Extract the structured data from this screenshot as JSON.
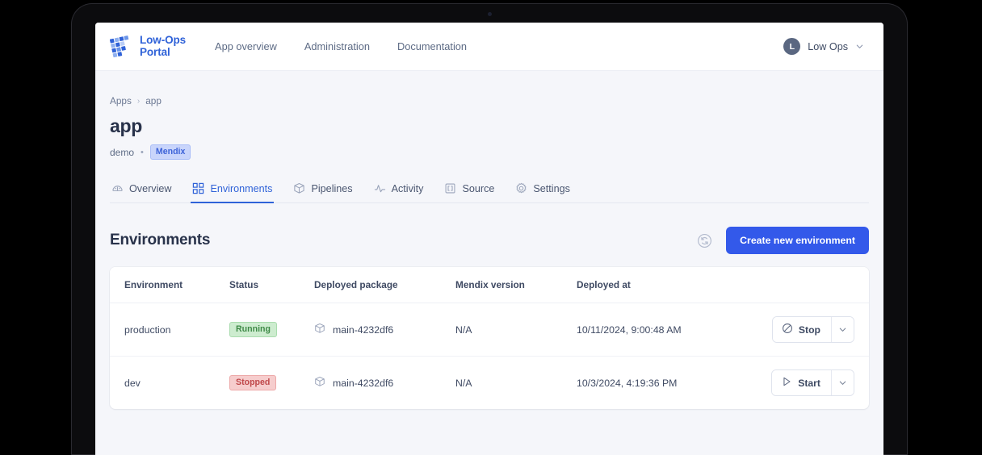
{
  "brand": {
    "name": "Low-Ops\nPortal",
    "logo_icon": "mosaic-logo-icon",
    "accent_color": "#2f62d8"
  },
  "topnav": {
    "links": [
      {
        "label": "App overview"
      },
      {
        "label": "Administration"
      },
      {
        "label": "Documentation"
      }
    ],
    "user": {
      "initial": "L",
      "name": "Low Ops",
      "caret_icon": "chevron-down-icon"
    }
  },
  "breadcrumb": {
    "items": [
      {
        "label": "Apps"
      },
      {
        "label": "app"
      }
    ],
    "separator": "›"
  },
  "page": {
    "title": "app",
    "owner": "demo",
    "separator_dot": "•",
    "tech_badge": "Mendix"
  },
  "tabs": [
    {
      "label": "Overview",
      "icon": "gauge-icon",
      "active": false
    },
    {
      "label": "Environments",
      "icon": "grid-icon",
      "active": true
    },
    {
      "label": "Pipelines",
      "icon": "package-icon",
      "active": false
    },
    {
      "label": "Activity",
      "icon": "pulse-icon",
      "active": false
    },
    {
      "label": "Source",
      "icon": "code-braces-icon",
      "active": false
    },
    {
      "label": "Settings",
      "icon": "gear-icon",
      "active": false
    }
  ],
  "section": {
    "title": "Environments",
    "refresh_icon": "refresh-icon",
    "create_button": "Create new environment",
    "create_button_color": "#3359ea"
  },
  "table": {
    "columns": [
      "Environment",
      "Status",
      "Deployed package",
      "Mendix version",
      "Deployed at",
      ""
    ],
    "rows": [
      {
        "environment": "production",
        "status": "Running",
        "status_kind": "running",
        "status_color": "#3f8a47",
        "package": "main-4232df6",
        "package_icon": "package-icon",
        "mendix_version": "N/A",
        "deployed_at": "10/11/2024, 9:00:48 AM",
        "action_label": "Stop",
        "action_icon": "stop-circle-icon",
        "caret_icon": "chevron-down-icon"
      },
      {
        "environment": "dev",
        "status": "Stopped",
        "status_kind": "stopped",
        "status_color": "#c0484a",
        "package": "main-4232df6",
        "package_icon": "package-icon",
        "mendix_version": "N/A",
        "deployed_at": "10/3/2024, 4:19:36 PM",
        "action_label": "Start",
        "action_icon": "play-icon",
        "caret_icon": "chevron-down-icon"
      }
    ]
  }
}
